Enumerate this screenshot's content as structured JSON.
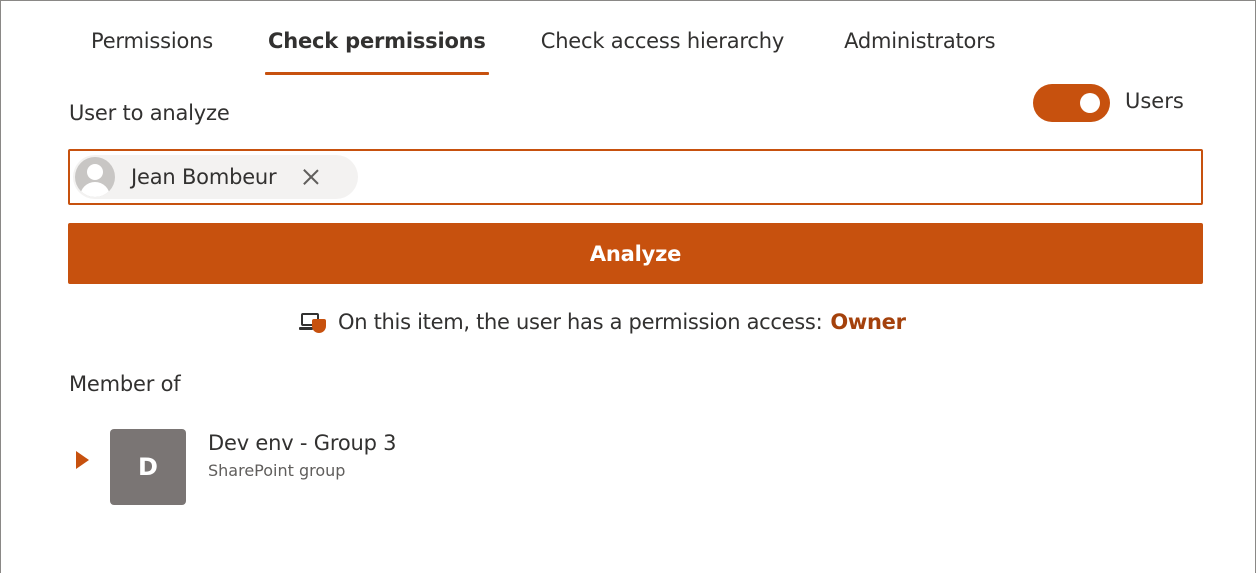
{
  "tabs": [
    {
      "label": "Permissions",
      "active": false
    },
    {
      "label": "Check permissions",
      "active": true
    },
    {
      "label": "Check access hierarchy",
      "active": false
    },
    {
      "label": "Administrators",
      "active": false
    }
  ],
  "user_section": {
    "label": "User to analyze",
    "toggle": {
      "label": "Users",
      "on": true
    }
  },
  "picker": {
    "selected_user": "Jean Bombeur"
  },
  "analyze_button": {
    "label": "Analyze"
  },
  "result": {
    "text": "On this item, the user has a permission access:",
    "value": "Owner"
  },
  "member_of": {
    "title": "Member of",
    "groups": [
      {
        "initial": "D",
        "name": "Dev env - Group 3",
        "type": "SharePoint group"
      }
    ]
  },
  "colors": {
    "accent": "#c7510e",
    "accent_text": "#a4410c",
    "group_avatar": "#7a7574"
  }
}
